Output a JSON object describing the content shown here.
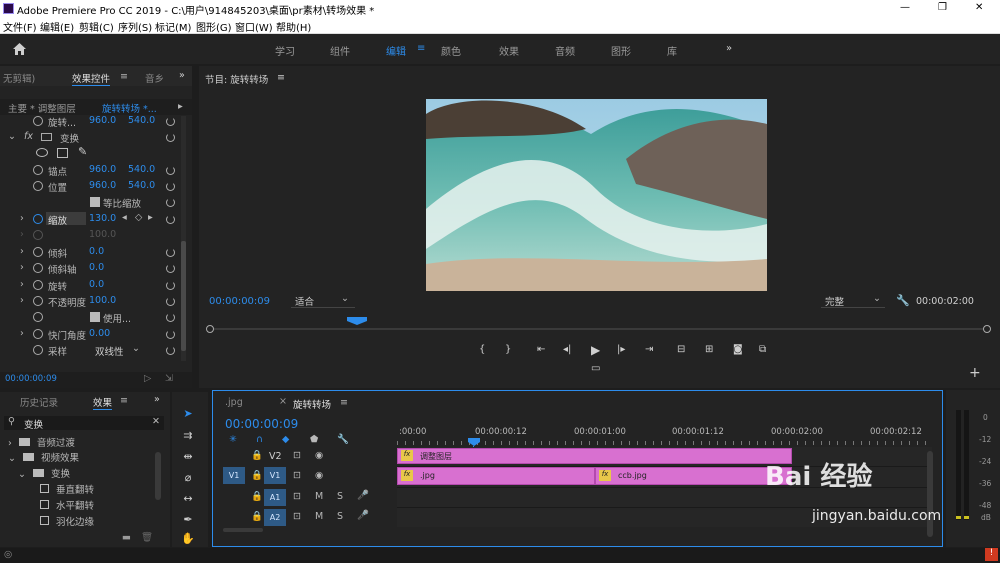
{
  "window": {
    "title": "Adobe Premiere Pro CC 2019 - C:\\用户\\914845203\\桌面\\pr素材\\转场效果 *",
    "controls": [
      "—",
      "❐",
      "✕"
    ]
  },
  "menu": [
    "文件(F)",
    "编辑(E)",
    "剪辑(C)",
    "序列(S)",
    "标记(M)",
    "图形(G)",
    "窗口(W)",
    "帮助(H)"
  ],
  "workspaces": {
    "tabs": [
      "学习",
      "组件",
      "编辑",
      "颜色",
      "效果",
      "音频",
      "图形",
      "库"
    ],
    "active": "编辑",
    "more": "»"
  },
  "effect_controls": {
    "tabs": [
      "无剪辑)",
      "效果控件",
      "音乡"
    ],
    "tab_menu": "≡",
    "source_label": "主要 * 调整图层",
    "clip_label": "旋转转场 *...",
    "rows": [
      {
        "name": "旋转...",
        "v1": "960.0",
        "v2": "540.0"
      },
      {
        "name": "变换"
      },
      {
        "name": "锚点",
        "v1": "960.0",
        "v2": "540.0"
      },
      {
        "name": "位置",
        "v1": "960.0",
        "v2": "540.0"
      },
      {
        "name": "等比缩放"
      },
      {
        "name": "缩放",
        "v1": "130.0"
      },
      {
        "name": "",
        "v1": "100.0"
      },
      {
        "name": "倾斜",
        "v1": "0.0"
      },
      {
        "name": "倾斜轴",
        "v1": "0.0"
      },
      {
        "name": "旋转",
        "v1": "0.0"
      },
      {
        "name": "不透明度",
        "v1": "100.0"
      },
      {
        "name": "使用..."
      },
      {
        "name": "快门角度",
        "v1": "0.00"
      },
      {
        "name": "采样",
        "v1": "双线性"
      }
    ],
    "timecode": "00:00:00:09"
  },
  "program": {
    "title": "节目: 旋转转场",
    "menu": "≡",
    "timecode": "00:00:00:09",
    "fit": "适合",
    "quality": "完整",
    "duration": "00:00:02:00"
  },
  "effects_panel": {
    "tabs": [
      "历史记录",
      "效果"
    ],
    "menu": "≡",
    "more": "»",
    "search": "变换",
    "tree": [
      {
        "label": "音频过渡",
        "level": 0
      },
      {
        "label": "视频效果",
        "level": 0
      },
      {
        "label": "变换",
        "level": 1
      },
      {
        "label": "垂直翻转",
        "level": 2
      },
      {
        "label": "水平翻转",
        "level": 2
      },
      {
        "label": "羽化边缘",
        "level": 2
      }
    ]
  },
  "timeline": {
    "tabs": [
      ".jpg",
      "旋转转场"
    ],
    "menu": "≡",
    "timecode": "00:00:00:09",
    "ruler": [
      ":00:00",
      "00:00:00:12",
      "00:00:01:00",
      "00:00:01:12",
      "00:00:02:00",
      "00:00:02:12"
    ],
    "tracks": [
      {
        "src": "",
        "name": "V2"
      },
      {
        "src": "V1",
        "name": "V1"
      },
      {
        "src": "",
        "name": "A1"
      },
      {
        "src": "",
        "name": "A2"
      }
    ],
    "clips": {
      "adjust": "调整图层",
      "jpg": ".jpg",
      "ccb": "ccb.jpg",
      "fx": "fx"
    }
  },
  "meters": {
    "labels": [
      "0",
      "-12",
      "-24",
      "-36",
      "-48",
      "dB"
    ]
  },
  "watermark": {
    "brand": "Bai 经验",
    "url": "jingyan.baidu.com"
  },
  "colors": {
    "accent": "#2d8ceb",
    "clip": "#d870d0",
    "panel": "#232323"
  }
}
